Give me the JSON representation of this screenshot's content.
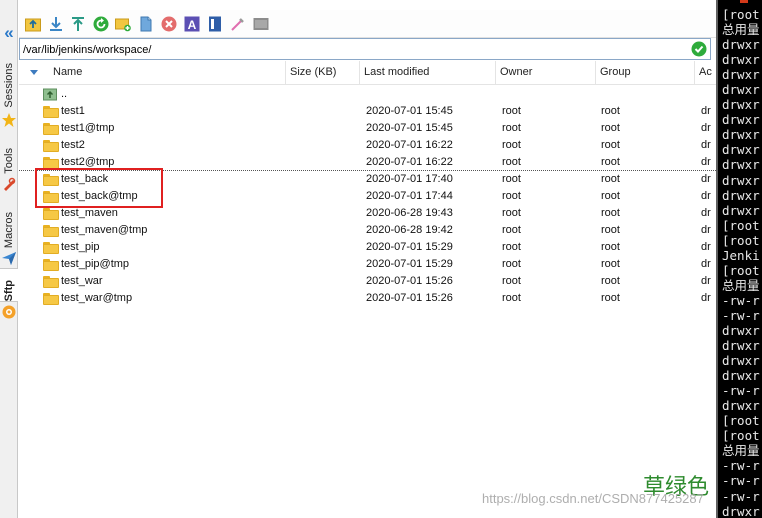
{
  "sidebar": {
    "collapse_glyph": "«",
    "tabs": [
      {
        "label": "Sessions",
        "icon": "sessions-icon"
      },
      {
        "label": "Tools",
        "icon": "tools-icon"
      },
      {
        "label": "Macros",
        "icon": "macros-icon"
      },
      {
        "label": "Sftp",
        "icon": "sftp-icon",
        "active": true
      }
    ]
  },
  "toolbar": {
    "buttons": [
      "parent-directory-icon",
      "download-icon",
      "upload-icon",
      "refresh-icon",
      "new-folder-icon",
      "new-file-icon",
      "delete-icon",
      "rename-icon",
      "permissions-icon",
      "edit-icon",
      "terminal-icon"
    ]
  },
  "path_bar": {
    "value": "/var/lib/jenkins/workspace/",
    "go_icon": "checkmark-icon"
  },
  "columns": {
    "name": "Name",
    "size": "Size (KB)",
    "modified": "Last modified",
    "owner": "Owner",
    "group": "Group",
    "attr": "Ac"
  },
  "parent_row": {
    "name": ".."
  },
  "files": [
    {
      "name": "test1",
      "modified": "2020-07-01 15:45",
      "owner": "root",
      "group": "root",
      "attr": "dr"
    },
    {
      "name": "test1@tmp",
      "modified": "2020-07-01 15:45",
      "owner": "root",
      "group": "root",
      "attr": "dr"
    },
    {
      "name": "test2",
      "modified": "2020-07-01 16:22",
      "owner": "root",
      "group": "root",
      "attr": "dr"
    },
    {
      "name": "test2@tmp",
      "modified": "2020-07-01 16:22",
      "owner": "root",
      "group": "root",
      "attr": "dr"
    },
    {
      "name": "test_back",
      "modified": "2020-07-01 17:40",
      "owner": "root",
      "group": "root",
      "attr": "dr"
    },
    {
      "name": "test_back@tmp",
      "modified": "2020-07-01 17:44",
      "owner": "root",
      "group": "root",
      "attr": "dr"
    },
    {
      "name": "test_maven",
      "modified": "2020-06-28 19:43",
      "owner": "root",
      "group": "root",
      "attr": "dr"
    },
    {
      "name": "test_maven@tmp",
      "modified": "2020-06-28 19:42",
      "owner": "root",
      "group": "root",
      "attr": "dr"
    },
    {
      "name": "test_pip",
      "modified": "2020-07-01 15:29",
      "owner": "root",
      "group": "root",
      "attr": "dr"
    },
    {
      "name": "test_pip@tmp",
      "modified": "2020-07-01 15:29",
      "owner": "root",
      "group": "root",
      "attr": "dr"
    },
    {
      "name": "test_war",
      "modified": "2020-07-01 15:26",
      "owner": "root",
      "group": "root",
      "attr": "dr"
    },
    {
      "name": "test_war@tmp",
      "modified": "2020-07-01 15:26",
      "owner": "root",
      "group": "root",
      "attr": "dr"
    }
  ],
  "terminal": {
    "lines": [
      "[root",
      "总用量",
      "drwxr",
      "drwxr",
      "drwxr",
      "drwxr",
      "drwxr",
      "drwxr",
      "drwxr",
      "drwxr",
      "drwxr",
      "drwxr",
      "drwxr",
      "drwxr",
      "[root",
      "[root",
      "Jenki",
      "[root",
      "总用量",
      "-rw-r",
      "-rw-r",
      "drwxr",
      "drwxr",
      "drwxr",
      "drwxr",
      "-rw-r",
      "drwxr",
      "[root",
      "[root",
      "总用量",
      "-rw-r",
      "-rw-r",
      "-rw-r",
      "drwxr"
    ]
  },
  "watermark": {
    "caption": "草绿色",
    "url": "https://blog.csdn.net/CSDN877425287"
  },
  "colors": {
    "highlight_border": "#e02020",
    "folder": "#f6c845",
    "accent": "#2a79c9",
    "terminal_bg": "#000000"
  }
}
